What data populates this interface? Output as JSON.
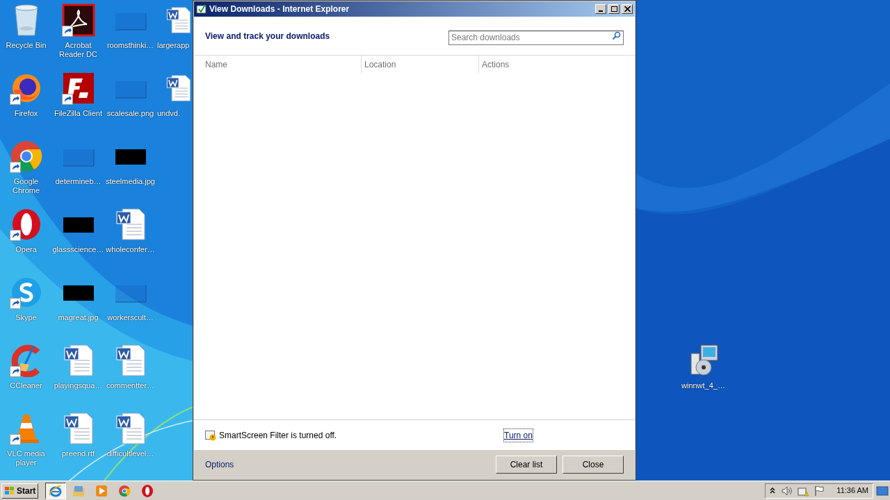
{
  "desktop": {
    "columns": [
      [
        {
          "label": "Recycle Bin",
          "kind": "recycle-bin",
          "shortcut": false
        },
        {
          "label": "Firefox",
          "kind": "firefox",
          "shortcut": true
        },
        {
          "label": "Google Chrome",
          "kind": "chrome",
          "shortcut": true
        },
        {
          "label": "Opera",
          "kind": "opera",
          "shortcut": true
        },
        {
          "label": "Skype",
          "kind": "skype",
          "shortcut": true
        },
        {
          "label": "CCleaner",
          "kind": "ccleaner",
          "shortcut": true
        },
        {
          "label": "VLC media player",
          "kind": "vlc",
          "shortcut": true
        }
      ],
      [
        {
          "label": "Acrobat Reader DC",
          "kind": "acrobat",
          "shortcut": true
        },
        {
          "label": "FileZilla Client",
          "kind": "filezilla",
          "shortcut": true
        },
        {
          "label": "determineb…",
          "kind": "blank-image",
          "shortcut": false
        },
        {
          "label": "glassscience…",
          "kind": "black-image",
          "shortcut": false
        },
        {
          "label": "magreat.jpg",
          "kind": "black-image",
          "shortcut": false
        },
        {
          "label": "playingsqua…",
          "kind": "word",
          "shortcut": false
        },
        {
          "label": "preend.rtf",
          "kind": "word",
          "shortcut": false
        }
      ],
      [
        {
          "label": "roomsthinki…",
          "kind": "blank-image",
          "shortcut": false
        },
        {
          "label": "scalesale.png",
          "kind": "blank-image",
          "shortcut": false
        },
        {
          "label": "steelmedia.jpg",
          "kind": "black-image",
          "shortcut": false
        },
        {
          "label": "wholeconfer…",
          "kind": "word",
          "shortcut": false
        },
        {
          "label": "workerscult…",
          "kind": "blank-image",
          "shortcut": false
        },
        {
          "label": "commentter…",
          "kind": "word",
          "shortcut": false
        },
        {
          "label": "difficultlevel…",
          "kind": "word",
          "shortcut": false
        }
      ],
      [
        {
          "label": "largerapp",
          "kind": "word",
          "shortcut": false
        },
        {
          "label": "undvd.",
          "kind": "word",
          "shortcut": false
        }
      ]
    ],
    "right_icons": [
      {
        "label": "winnwt_4_…",
        "kind": "installer",
        "shortcut": false
      }
    ]
  },
  "window": {
    "title": "View Downloads - Internet Explorer",
    "heading": "View and track your downloads",
    "search": {
      "placeholder": "Search downloads"
    },
    "columns": [
      "Name",
      "Location",
      "Actions"
    ],
    "notice": {
      "text": "SmartScreen Filter is turned off.",
      "link": "Turn on"
    },
    "options_link": "Options",
    "buttons": [
      "Clear list",
      "Close"
    ]
  },
  "taskbar": {
    "start": "Start",
    "apps": [
      {
        "kind": "ie",
        "selected": true
      },
      {
        "kind": "explorer",
        "selected": false
      },
      {
        "kind": "media",
        "selected": false
      },
      {
        "kind": "chrome",
        "selected": false
      },
      {
        "kind": "opera",
        "selected": false
      }
    ],
    "time": "11:36 AM"
  }
}
